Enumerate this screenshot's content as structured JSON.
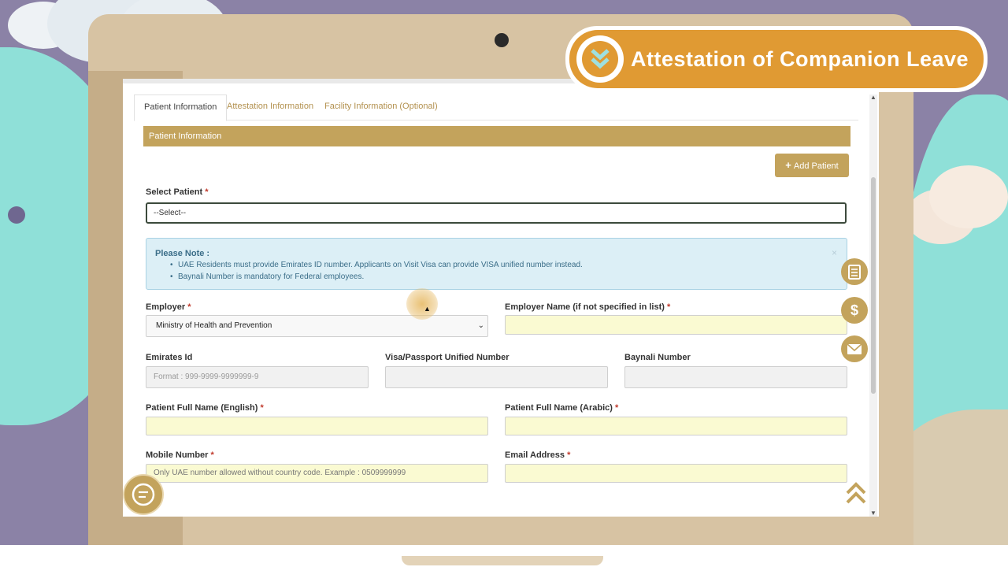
{
  "banner": {
    "title": "Attestation of Companion Leave"
  },
  "tabs": [
    {
      "label": "Patient Information",
      "active": true
    },
    {
      "label": "Attestation Information",
      "active": false
    },
    {
      "label": "Facility Information (Optional)",
      "active": false
    }
  ],
  "section": {
    "title": "Patient Information"
  },
  "add_patient": {
    "label": "Add Patient"
  },
  "select_patient": {
    "label": "Select Patient",
    "required": "*",
    "value": "--Select--"
  },
  "notice": {
    "title": "Please Note :",
    "items": [
      "UAE Residents must provide Emirates ID number. Applicants on Visit Visa can provide VISA unified number instead.",
      "Baynali Number is mandatory for Federal employees."
    ],
    "close": "×"
  },
  "form": {
    "employer": {
      "label": "Employer",
      "required": "*",
      "value": "Ministry of Health and Prevention"
    },
    "employer_name": {
      "label": "Employer Name (if not specified in list)",
      "required": "*",
      "value": ""
    },
    "emirates_id": {
      "label": "Emirates Id",
      "placeholder": "Format : 999-9999-9999999-9"
    },
    "visa_number": {
      "label": "Visa/Passport Unified Number",
      "value": ""
    },
    "baynali": {
      "label": "Baynali Number",
      "value": ""
    },
    "name_en": {
      "label": "Patient Full Name (English)",
      "required": "*",
      "value": ""
    },
    "name_ar": {
      "label": "Patient Full Name (Arabic)",
      "required": "*",
      "value": ""
    },
    "mobile": {
      "label": "Mobile Number",
      "required": "*",
      "placeholder": "Only UAE number allowed without country code. Example : 0509999999"
    },
    "email": {
      "label": "Email Address",
      "required": "*",
      "value": ""
    }
  },
  "icons": {
    "book": "book-icon",
    "dollar": "dollar-icon",
    "mail": "mail-icon",
    "chat": "chat-icon",
    "scroll_top": "double-chevron-up-icon",
    "banner": "double-chevron-down-icon"
  },
  "colors": {
    "accent": "#c3a35c",
    "banner": "#e09a33",
    "notice_bg": "#dceff6",
    "required_field": "#fafad2"
  }
}
